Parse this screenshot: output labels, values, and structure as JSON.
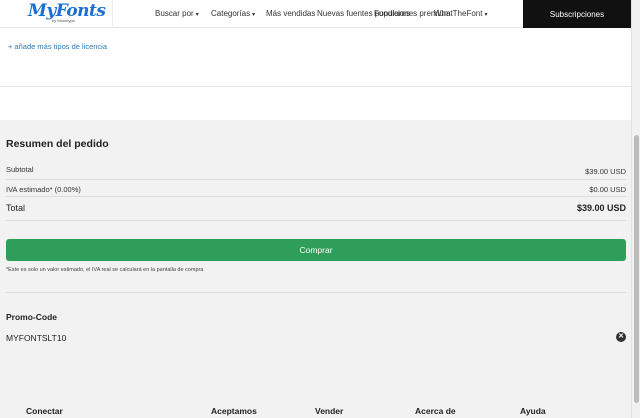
{
  "header": {
    "logo_text": "MyFonts",
    "logo_sub": "by Monotype.",
    "nav": [
      {
        "label": "Buscar por",
        "caret": "▾"
      },
      {
        "label": "Categorías",
        "caret": "▾"
      },
      {
        "label": "Más vendidas",
        "caret": ""
      },
      {
        "label": "Nuevas fuentes populares",
        "caret": ""
      },
      {
        "label": "Fundiciones premium",
        "caret": ""
      },
      {
        "label": "WhatTheFont",
        "caret": "▾"
      }
    ],
    "subscribe_label": "Subscripciones"
  },
  "license": {
    "add_link": "+ añade más tipos de licencia"
  },
  "summary": {
    "title": "Resumen del pedido",
    "subtotal_label": "Subtotal",
    "subtotal_value": "$39.00 USD",
    "tax_label": "IVA estimado* (0.00%)",
    "tax_value": "$0.00 USD",
    "total_label": "Total",
    "total_value": "$39.00 USD",
    "buy_label": "Comprar",
    "note": "*Este es solo un valor estimado, el IVA real se calculará en la pantalla de compra",
    "promo_label": "Promo-Code",
    "promo_value": "MYFONTSLT10",
    "remove_glyph": "✕"
  },
  "footer": {
    "headings": [
      "Conectar",
      "Aceptamos",
      "Vender",
      "Acerca de",
      "Ayuda"
    ]
  },
  "colors": {
    "accent_link": "#2a7ab8",
    "buy_button": "#2e9e5a",
    "header_cta": "#111111"
  },
  "icons": [
    "chevron-down-icon",
    "close-circle-icon"
  ]
}
